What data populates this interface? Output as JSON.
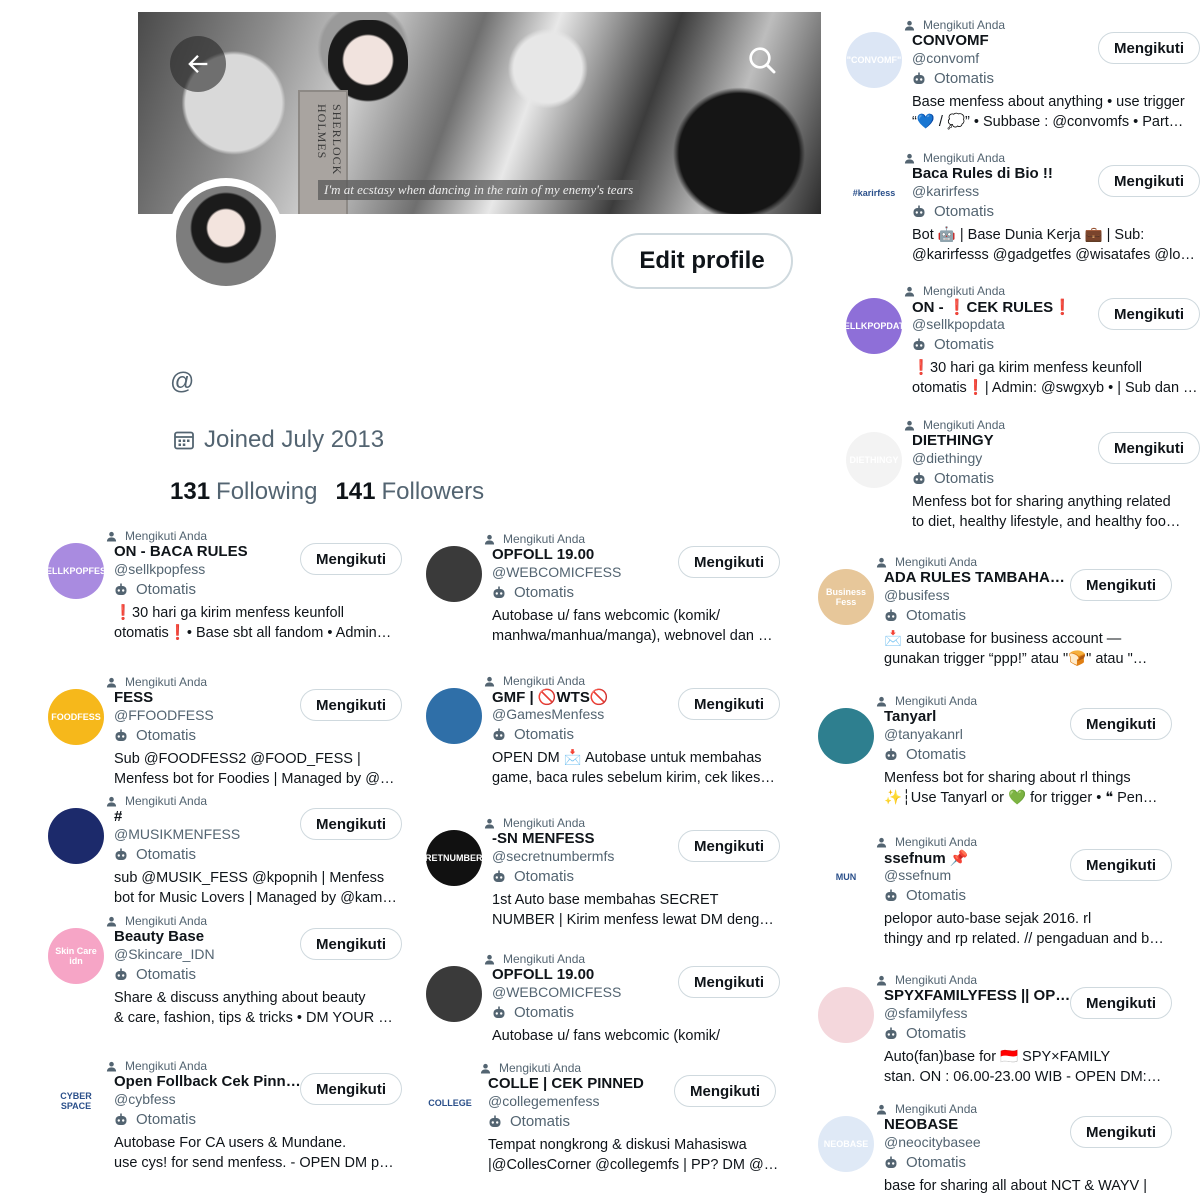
{
  "profile": {
    "banner_caption": "I'm at ecstasy when dancing in the rain of my enemy's tears",
    "banner_book_title": "SHERLOCK HOLMES",
    "edit_button": "Edit profile",
    "handle": "@",
    "joined": "Joined July 2013",
    "following_count": "131",
    "following_label": "Following",
    "followers_count": "141",
    "followers_label": "Followers"
  },
  "ui": {
    "follows_you": "Mengikuti Anda",
    "following_button": "Mengikuti",
    "automated": "Otomatis"
  },
  "accounts": [
    {
      "name": "CONVOMF",
      "handle": "@convomf",
      "bio1": "Base menfess about anything • use trigger",
      "bio2": "“💙 / 💭” • Subbase : @convomfs • Part…",
      "avatar_text": "\"CONVOMF\"",
      "avatar_color": "#dce6f5"
    },
    {
      "name": "Baca Rules di Bio !!",
      "handle": "@karirfess",
      "bio1": "Bot 🤖 | Base Dunia Kerja 💼 | Sub:",
      "bio2": "@karirfesss @gadgetfes @wisatafes @lo…",
      "avatar_text": "#karirfess",
      "avatar_color": "#ffffff"
    },
    {
      "name": "ON - ❗CEK RULES❗",
      "handle": "@sellkpopdata",
      "bio1": "❗30 hari ga kirim menfess keunfoll",
      "bio2": "otomatis❗| Admin: @swgxyb • | Sub dan …",
      "avatar_text": "SELLKPOPDATA",
      "avatar_color": "#8e6fd8"
    },
    {
      "name": "DIETHINGY",
      "handle": "@diethingy",
      "bio1": "Menfess bot for sharing anything related",
      "bio2": "to diet, healthy lifestyle, and healthy foo…",
      "avatar_text": "DIETHINGY",
      "avatar_color": "#f3f3f3"
    },
    {
      "name": "ON - BACA RULES",
      "handle": "@sellkpopfess",
      "bio1": "❗30 hari ga kirim menfess keunfoll",
      "bio2": "otomatis❗• Base sbt all fandom • Admin…",
      "avatar_text": "SELLKPOPFESS",
      "avatar_color": "#a98be0"
    },
    {
      "name": "OPFOLL 19.00",
      "handle": "@WEBCOMICFESS",
      "bio1": "Autobase u/ fans webcomic (komik/",
      "bio2": "manhwa/manhua/manga), webnovel dan …",
      "avatar_text": "",
      "avatar_color": "#3a3a3a"
    },
    {
      "name": "ADA RULES TAMBAHAN …",
      "handle": "@busifess",
      "bio1": "📩 autobase for business account —",
      "bio2": "gunakan trigger “ppp!” atau \"🍞\" atau \"…",
      "avatar_text": "Business Fess",
      "avatar_color": "#e7c79a"
    },
    {
      "name": "FESS",
      "handle": "@FFOODFESS",
      "bio1": "Sub @FOODFESS2 @FOOD_FESS |",
      "bio2": "Menfess bot for Foodies | Managed by @…",
      "avatar_text": "FOODFESS",
      "avatar_color": "#f6b81b"
    },
    {
      "name": "GMF | 🚫WTS🚫",
      "handle": "@GamesMenfess",
      "bio1": "OPEN DM 📩 Autobase untuk membahas",
      "bio2": "game, baca rules sebelum kirim, cek likes…",
      "avatar_text": "",
      "avatar_color": "#2f6fa8"
    },
    {
      "name": "Tanyarl",
      "handle": "@tanyakanrl",
      "bio1": "Menfess bot for sharing about rl things",
      "bio2": "✨┆Use Tanyarl or 💚 for trigger • ❝ Pen…",
      "avatar_text": "",
      "avatar_color": "#2e7f8f"
    },
    {
      "name": "#",
      "handle": "@MUSIKMENFESS",
      "bio1": "sub @MUSIK_FESS @kpopnih | Menfess",
      "bio2": "bot for Music Lovers | Managed by @kam…",
      "avatar_text": "",
      "avatar_color": "#1c2a6b"
    },
    {
      "name": "-SN MENFESS",
      "handle": "@secretnumbermfs",
      "bio1": "1st Auto base membahas SECRET",
      "bio2": "NUMBER | Kirim menfess lewat DM deng…",
      "avatar_text": "SECRETNUMBERMFS",
      "avatar_color": "#111111"
    },
    {
      "name": "ssefnum 📌",
      "handle": "@ssefnum",
      "bio1": "pelopor auto-base sejak 2016. rl",
      "bio2": "thingy and rp related. // pengaduan and b…",
      "avatar_text": "MUN",
      "avatar_color": "#ffffff"
    },
    {
      "name": "Beauty Base",
      "handle": "@Skincare_IDN",
      "bio1": "Share & discuss anything about beauty",
      "bio2": "& care, fashion, tips & tricks • DM YOUR …",
      "avatar_text": "Skin Care idn",
      "avatar_color": "#f6a5c6"
    },
    {
      "name": "OPFOLL 19.00",
      "handle": "@WEBCOMICFESS",
      "bio1": "Autobase u/ fans webcomic (komik/",
      "bio2": "",
      "avatar_text": "",
      "avatar_color": "#3a3a3a"
    },
    {
      "name": "SPYXFAMILYFESS || OPF…",
      "handle": "@sfamilyfess",
      "bio1": "Auto(fan)base for 🇮🇩 SPY×FAMILY",
      "bio2": "stan. ON : 06.00-23.00 WIB - OPEN DM:…",
      "avatar_text": "",
      "avatar_color": "#f4d7dc"
    },
    {
      "name": "Open Follback Cek Pinne…",
      "handle": "@cybfess",
      "bio1": "Autobase For CA users & Mundane.",
      "bio2": "use cys! for send menfess. - OPEN DM p…",
      "avatar_text": "CYBER SPACE",
      "avatar_color": "#ffffff"
    },
    {
      "name": "COLLE | CEK PINNED",
      "handle": "@collegemenfess",
      "bio1": "Tempat nongkrong & diskusi Mahasiswa",
      "bio2": "|@CollesCorner @collegemfs | PP? DM @…",
      "avatar_text": "COLLEGE",
      "avatar_color": "#ffffff"
    },
    {
      "name": "NEOBASE",
      "handle": "@neocitybasee",
      "bio1": "base for sharing all about NCT & WAYV |",
      "bio2": "",
      "avatar_text": "NEOBASE",
      "avatar_color": "#dfe9f6"
    }
  ]
}
